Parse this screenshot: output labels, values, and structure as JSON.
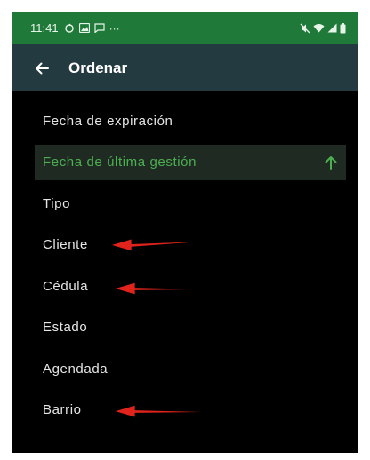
{
  "status_bar": {
    "time": "11:41",
    "left_icons": [
      "sync-icon",
      "image-icon",
      "message-icon",
      "more-dots-icon"
    ],
    "right_icons": [
      "mute-icon",
      "wifi-icon",
      "signal-icon",
      "battery-icon"
    ]
  },
  "app_bar": {
    "title": "Ordenar",
    "back_icon": "arrow-left-icon"
  },
  "sort_options": [
    {
      "label": "Fecha de expiración",
      "selected": false
    },
    {
      "label": "Fecha de última gestión",
      "selected": true,
      "direction": "ascending"
    },
    {
      "label": "Tipo",
      "selected": false
    },
    {
      "label": "Cliente",
      "selected": false,
      "annotated": true
    },
    {
      "label": "Cédula",
      "selected": false,
      "annotated": true
    },
    {
      "label": "Estado",
      "selected": false
    },
    {
      "label": "Agendada",
      "selected": false
    },
    {
      "label": "Barrio",
      "selected": false,
      "annotated": true
    }
  ],
  "colors": {
    "status_bar": "#1f7a3a",
    "app_bar": "#223a40",
    "background": "#000000",
    "accent": "#4caf50",
    "annotation_arrow": "#e0231b"
  }
}
